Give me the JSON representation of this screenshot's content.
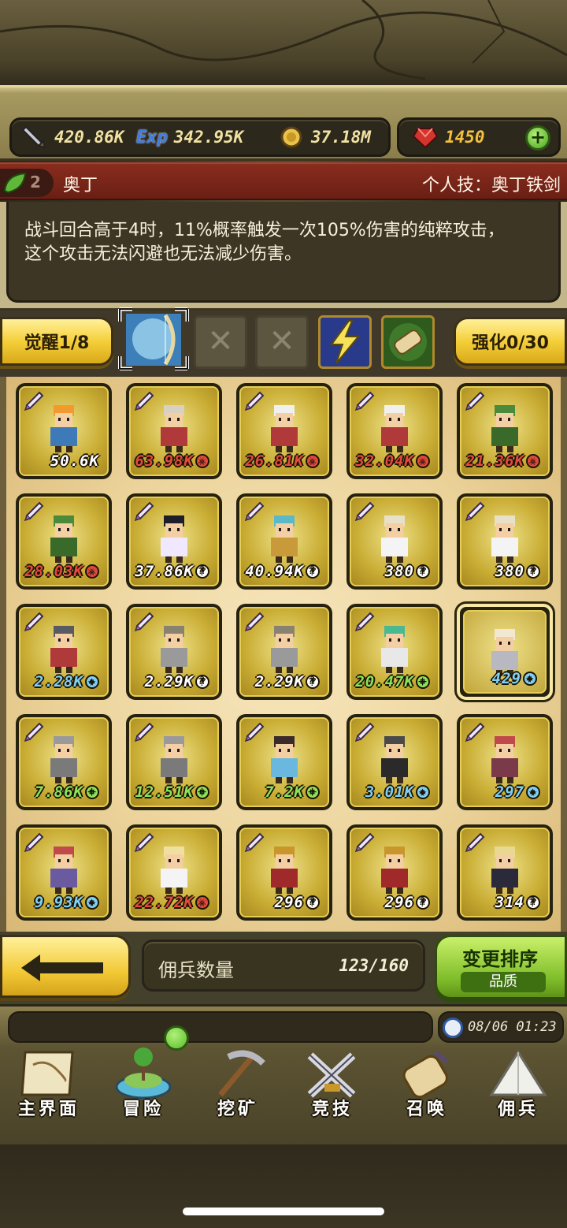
{
  "resources": {
    "attack": "420.86K",
    "exp": "342.95K",
    "gold": "37.18M",
    "gems": "1450",
    "exp_icon_label": "Exp"
  },
  "hero": {
    "rank": "2",
    "name": "奥丁",
    "skill": "个人技：奥丁铁剑",
    "description_line1": "战斗回合高于4时，11%概率触发一次105%伤害的纯粹攻击，",
    "description_line2": "这个攻击无法闪避也无法减少伤害。"
  },
  "awaken": {
    "label": "觉醒1/8",
    "enhance_label": "强化0/30"
  },
  "heroes": [
    {
      "power": "50.6K",
      "color": "white",
      "cls": ""
    },
    {
      "power": "63.98K",
      "color": "red",
      "cls": "red"
    },
    {
      "power": "26.81K",
      "color": "red",
      "cls": "red"
    },
    {
      "power": "32.04K",
      "color": "red",
      "cls": "red"
    },
    {
      "power": "21.36K",
      "color": "red",
      "cls": "red"
    },
    {
      "power": "28.03K",
      "color": "red",
      "cls": "red"
    },
    {
      "power": "37.86K",
      "color": "white",
      "cls": "white"
    },
    {
      "power": "40.94K",
      "color": "white",
      "cls": "white"
    },
    {
      "power": "380",
      "color": "white",
      "cls": "white"
    },
    {
      "power": "380",
      "color": "white",
      "cls": "white"
    },
    {
      "power": "2.28K",
      "color": "blue",
      "cls": "blue"
    },
    {
      "power": "2.29K",
      "color": "white",
      "cls": "white"
    },
    {
      "power": "2.29K",
      "color": "white",
      "cls": "white"
    },
    {
      "power": "20.47K",
      "color": "green",
      "cls": "green"
    },
    {
      "power": "429",
      "color": "blue",
      "cls": "blue"
    },
    {
      "power": "7.86K",
      "color": "green",
      "cls": "green"
    },
    {
      "power": "12.51K",
      "color": "green",
      "cls": "green"
    },
    {
      "power": "7.2K",
      "color": "green",
      "cls": "green"
    },
    {
      "power": "3.01K",
      "color": "blue",
      "cls": "blue"
    },
    {
      "power": "297",
      "color": "blue",
      "cls": "blue"
    },
    {
      "power": "9.93K",
      "color": "blue",
      "cls": "blue"
    },
    {
      "power": "22.72K",
      "color": "red",
      "cls": "red"
    },
    {
      "power": "296",
      "color": "white",
      "cls": "white"
    },
    {
      "power": "296",
      "color": "white",
      "cls": "white"
    },
    {
      "power": "314",
      "color": "white",
      "cls": "white"
    }
  ],
  "roster": {
    "label": "佣兵数量",
    "count": "123/160"
  },
  "sort": {
    "label": "变更排序",
    "mode": "品质"
  },
  "datetime": "08/06 01:23",
  "nav": [
    {
      "label": "主界面",
      "icon": "map-scroll-icon"
    },
    {
      "label": "冒险",
      "icon": "island-icon"
    },
    {
      "label": "挖矿",
      "icon": "pickaxe-icon"
    },
    {
      "label": "竞技",
      "icon": "crossed-swords-icon"
    },
    {
      "label": "召唤",
      "icon": "summon-scroll-icon"
    },
    {
      "label": "佣兵",
      "icon": "tent-icon"
    }
  ]
}
